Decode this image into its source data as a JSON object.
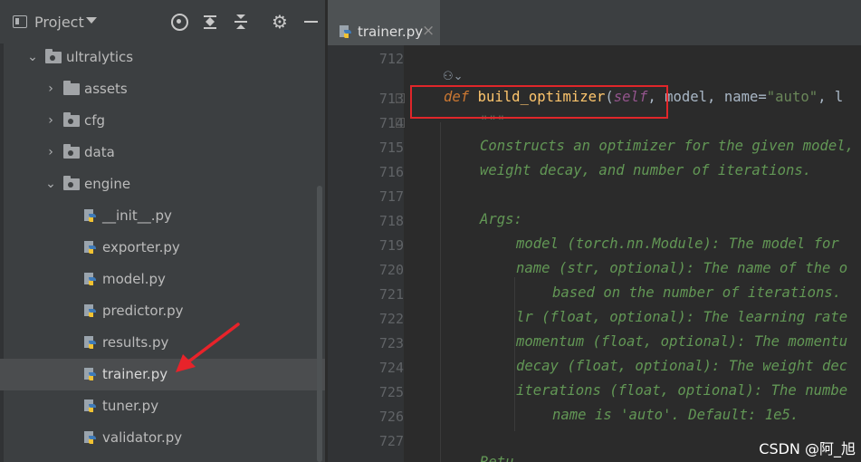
{
  "project_panel": {
    "title": "Project",
    "tree": [
      {
        "label": "ultralytics",
        "kind": "package",
        "expanded": true
      },
      {
        "label": "assets",
        "kind": "folder",
        "expanded": false
      },
      {
        "label": "cfg",
        "kind": "package",
        "expanded": false
      },
      {
        "label": "data",
        "kind": "package",
        "expanded": false
      },
      {
        "label": "engine",
        "kind": "package",
        "expanded": true
      },
      {
        "label": "__init__.py",
        "kind": "python-file"
      },
      {
        "label": "exporter.py",
        "kind": "python-file"
      },
      {
        "label": "model.py",
        "kind": "python-file"
      },
      {
        "label": "predictor.py",
        "kind": "python-file"
      },
      {
        "label": "results.py",
        "kind": "python-file"
      },
      {
        "label": "trainer.py",
        "kind": "python-file",
        "selected": true
      },
      {
        "label": "tuner.py",
        "kind": "python-file"
      },
      {
        "label": "validator.py",
        "kind": "python-file"
      }
    ],
    "header_icons": [
      "locate-icon",
      "expand-all-icon",
      "collapse-all-icon",
      "gear-icon",
      "hide-icon"
    ]
  },
  "editor": {
    "tab": {
      "label": "trainer.py",
      "close": "×"
    },
    "line_numbers": [
      "712",
      "713",
      "714",
      "715",
      "716",
      "717",
      "718",
      "719",
      "720",
      "721",
      "722",
      "723",
      "724",
      "725",
      "726",
      "727"
    ],
    "code": {
      "l713": {
        "def": "def",
        "fn": "build_optimizer",
        "open": "(",
        "self": "self",
        "rest": ", model, name=",
        "str": "\"auto\"",
        "tail": ", l"
      },
      "l714": "\"\"\"",
      "l715": "Constructs an optimizer for the given model,",
      "l716": "weight decay, and number of iterations.",
      "l718": "Args:",
      "l719": "model (torch.nn.Module): The model for",
      "l720": "name (str, optional): The name of the o",
      "l721": "based on the number of iterations.",
      "l722": "lr (float, optional): The learning rate",
      "l723": "momentum (float, optional): The momentu",
      "l724": "decay (float, optional): The weight dec",
      "l725": "iterations (float, optional): The numbe",
      "l726": "name is 'auto'. Default: 1e5.",
      "l728": "Retu"
    }
  },
  "watermark": "CSDN @阿_旭",
  "colors": {
    "highlight_box": "#e0262a",
    "annotation_arrow": "#e8232a"
  }
}
